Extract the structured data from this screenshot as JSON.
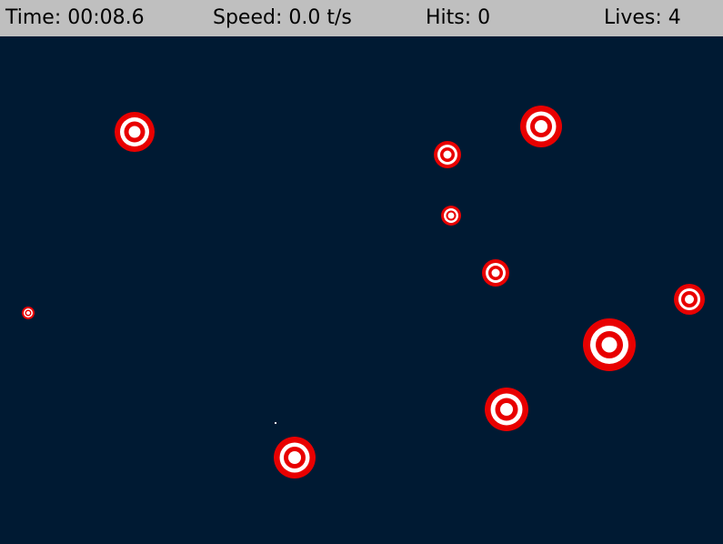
{
  "hud": {
    "time": "Time: 00:08.6",
    "speed": "Speed: 0.0 t/s",
    "hits": "Hits: 0",
    "lives": "Lives: 4"
  },
  "colors": {
    "background": "#001a33",
    "hud_bar": "#bfbfbf",
    "target_red": "#e80000",
    "target_white": "#ffffff"
  },
  "targets": [
    {
      "name": "target-1"
    },
    {
      "name": "target-2"
    },
    {
      "name": "target-3"
    },
    {
      "name": "target-4"
    },
    {
      "name": "target-5"
    },
    {
      "name": "target-6"
    },
    {
      "name": "target-7"
    },
    {
      "name": "target-8"
    },
    {
      "name": "target-9"
    },
    {
      "name": "target-10"
    }
  ]
}
